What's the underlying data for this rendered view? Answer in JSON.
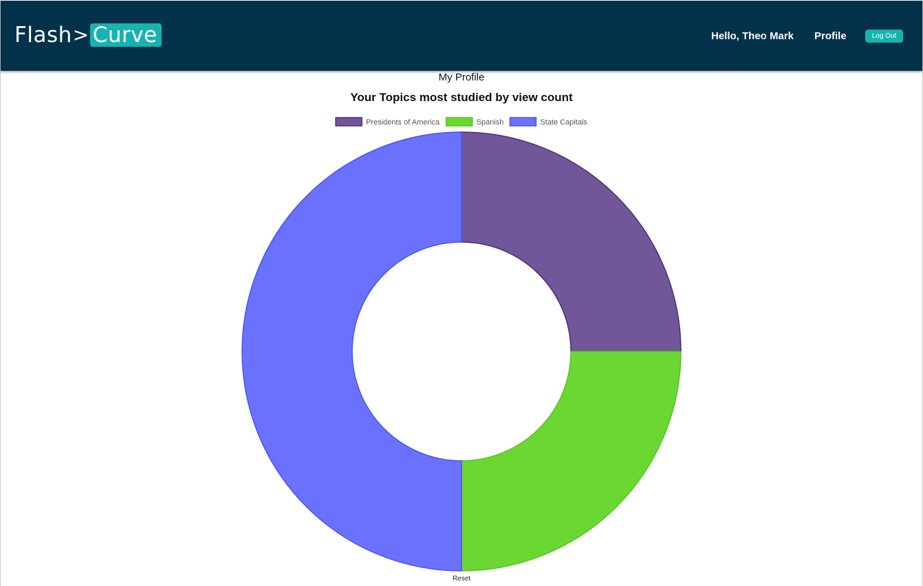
{
  "navbar": {
    "logo_left": "Flash",
    "logo_arrow": ">",
    "logo_right": "Curve",
    "greeting": "Hello, Theo Mark",
    "profile_link": "Profile",
    "logout_label": "Log Out"
  },
  "page": {
    "title": "My Profile",
    "reset_label": "Reset"
  },
  "colors": {
    "navbar": "#04324a",
    "accent": "#17b3b0"
  },
  "chart_data": {
    "type": "pie",
    "variant": "doughnut",
    "title": "Your Topics most studied by view count",
    "legend_position": "top",
    "labels": [
      "Presidents of America",
      "Spanish",
      "State Capitals"
    ],
    "values": [
      1,
      1,
      2
    ],
    "colors": [
      "#715699",
      "#6ad732",
      "#6a71ff"
    ],
    "border_colors": [
      "#4b2e7a",
      "#58c41f",
      "#4b53f0"
    ]
  }
}
